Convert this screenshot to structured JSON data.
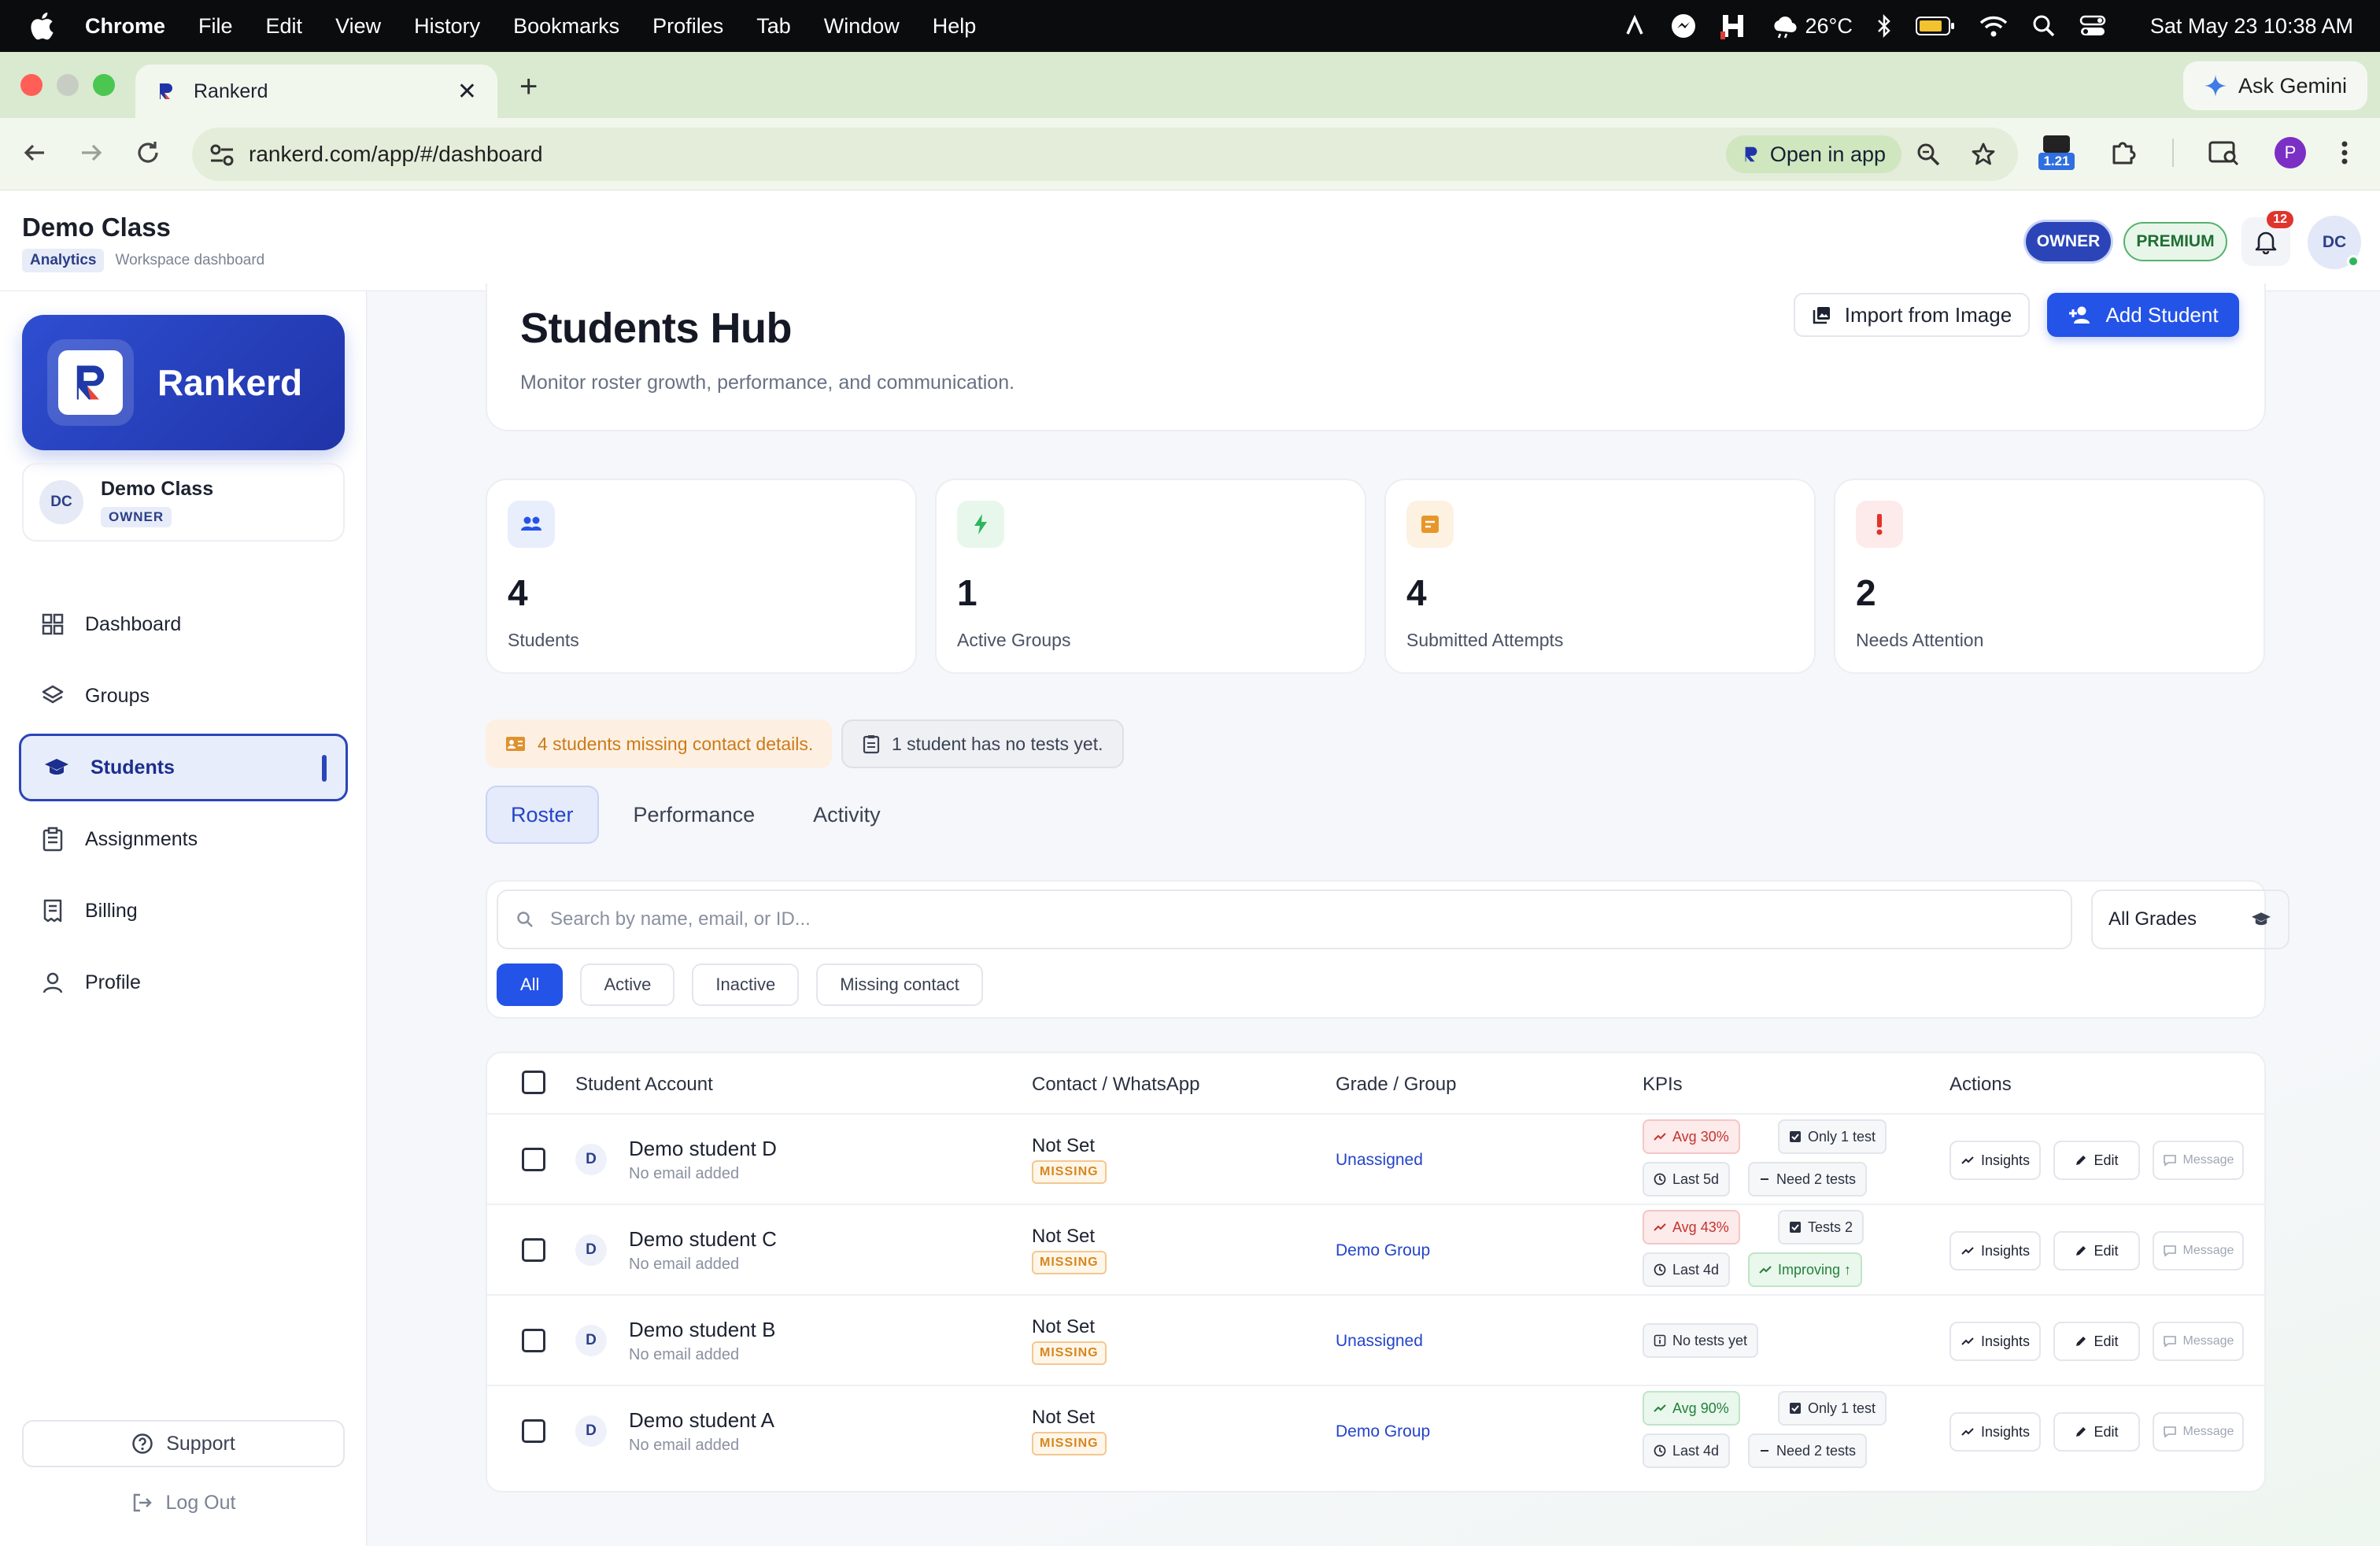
{
  "menubar": {
    "app": "Chrome",
    "items": [
      "File",
      "Edit",
      "View",
      "History",
      "Bookmarks",
      "Profiles",
      "Tab",
      "Window",
      "Help"
    ],
    "weather": "26°C",
    "datetime": "Sat May 23  10:38 AM"
  },
  "browser": {
    "tab_title": "Rankerd",
    "ask_gemini": "Ask Gemini",
    "url": "rankerd.com/app/#/dashboard",
    "open_in_app": "Open in app",
    "ext_badge": "1.21",
    "profile_initial": "P"
  },
  "header": {
    "title": "Demo Class",
    "crumb_section": "Analytics",
    "crumb_page": "Workspace dashboard",
    "owner_badge": "OWNER",
    "premium_badge": "PREMIUM",
    "notification_count": "12",
    "avatar_initials": "DC"
  },
  "sidebar": {
    "brand": "Rankerd",
    "workspace": {
      "initials": "DC",
      "name": "Demo Class",
      "role": "OWNER"
    },
    "items": [
      {
        "label": "Dashboard",
        "icon": "grid-icon"
      },
      {
        "label": "Groups",
        "icon": "layers-icon"
      },
      {
        "label": "Students",
        "icon": "graduation-cap-icon",
        "active": true
      },
      {
        "label": "Assignments",
        "icon": "clipboard-icon"
      },
      {
        "label": "Billing",
        "icon": "receipt-icon"
      },
      {
        "label": "Profile",
        "icon": "user-icon"
      }
    ],
    "support": "Support",
    "logout": "Log Out"
  },
  "hub": {
    "title": "Students Hub",
    "subtitle": "Monitor roster growth, performance, and communication.",
    "import_button": "Import from Image",
    "add_button": "Add Student"
  },
  "stats": [
    {
      "value": "4",
      "label": "Students",
      "icon": "users-icon",
      "color": "#2453e8"
    },
    {
      "value": "1",
      "label": "Active Groups",
      "icon": "bolt-icon",
      "color": "#2fb55d"
    },
    {
      "value": "4",
      "label": "Submitted Attempts",
      "icon": "task-icon",
      "color": "#e8962a"
    },
    {
      "value": "2",
      "label": "Needs Attention",
      "icon": "alert-icon",
      "color": "#e0342c"
    }
  ],
  "alerts": {
    "missing_contact": "4 students missing contact details.",
    "no_tests": "1 student has no tests yet."
  },
  "tabs": [
    "Roster",
    "Performance",
    "Activity"
  ],
  "filters": {
    "search_placeholder": "Search by name, email, or ID...",
    "grade_select": "All Grades",
    "chips": [
      "All",
      "Active",
      "Inactive",
      "Missing contact"
    ]
  },
  "table": {
    "headers": [
      "Student Account",
      "Contact / WhatsApp",
      "Grade / Group",
      "KPIs",
      "Actions"
    ],
    "actions": [
      "Insights",
      "Edit",
      "Message"
    ],
    "rows": [
      {
        "initial": "D",
        "name": "Demo student D",
        "email": "No email added",
        "contact": "Not Set",
        "contact_status": "MISSING",
        "group": "Unassigned",
        "kpis": [
          {
            "text": "Avg 30%",
            "tone": "red",
            "icon": "trend-icon"
          },
          {
            "text": "Only 1 test",
            "tone": "neutral",
            "icon": "check-square-icon"
          },
          {
            "text": "Last 5d",
            "tone": "neutral",
            "icon": "clock-icon"
          },
          {
            "text": "Need 2 tests",
            "tone": "neutral",
            "icon": "dash-icon"
          }
        ]
      },
      {
        "initial": "D",
        "name": "Demo student C",
        "email": "No email added",
        "contact": "Not Set",
        "contact_status": "MISSING",
        "group": "Demo Group",
        "kpis": [
          {
            "text": "Avg 43%",
            "tone": "red",
            "icon": "trend-icon"
          },
          {
            "text": "Tests 2",
            "tone": "neutral",
            "icon": "check-square-icon"
          },
          {
            "text": "Last 4d",
            "tone": "neutral",
            "icon": "clock-icon"
          },
          {
            "text": "Improving ↑",
            "tone": "green",
            "icon": "trend-icon"
          }
        ]
      },
      {
        "initial": "D",
        "name": "Demo student B",
        "email": "No email added",
        "contact": "Not Set",
        "contact_status": "MISSING",
        "group": "Unassigned",
        "kpis": [
          {
            "text": "No tests yet",
            "tone": "neutral",
            "icon": "info-icon"
          }
        ]
      },
      {
        "initial": "D",
        "name": "Demo student A",
        "email": "No email added",
        "contact": "Not Set",
        "contact_status": "MISSING",
        "group": "Demo Group",
        "kpis": [
          {
            "text": "Avg 90%",
            "tone": "green",
            "icon": "trend-icon"
          },
          {
            "text": "Only 1 test",
            "tone": "neutral",
            "icon": "check-square-icon"
          },
          {
            "text": "Last 4d",
            "tone": "neutral",
            "icon": "clock-icon"
          },
          {
            "text": "Need 2 tests",
            "tone": "neutral",
            "icon": "dash-icon"
          }
        ]
      }
    ]
  }
}
